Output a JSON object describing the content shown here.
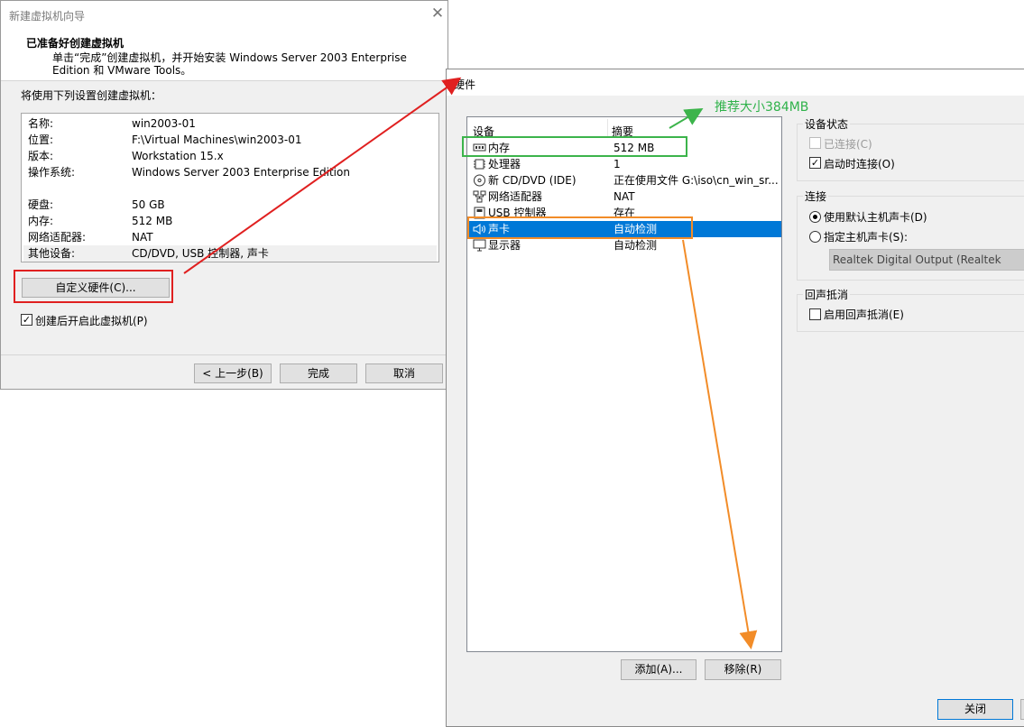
{
  "wizard": {
    "title": "新建虚拟机向导",
    "close_glyph": "✕",
    "heading": "已准备好创建虚拟机",
    "description": "单击“完成”创建虚拟机，并开始安装 Windows Server 2003 Enterprise Edition 和 VMware Tools。",
    "list_label": "将使用下列设置创建虚拟机：",
    "summary": [
      {
        "key": "名称:",
        "value": "win2003-01"
      },
      {
        "key": "位置:",
        "value": "F:\\Virtual Machines\\win2003-01"
      },
      {
        "key": "版本:",
        "value": "Workstation 15.x"
      },
      {
        "key": "操作系统:",
        "value": "Windows Server 2003 Enterprise Edition"
      },
      {
        "key": "硬盘:",
        "value": "50 GB"
      },
      {
        "key": "内存:",
        "value": "512 MB"
      },
      {
        "key": "网络适配器:",
        "value": "NAT"
      },
      {
        "key": "其他设备:",
        "value": "CD/DVD, USB 控制器, 声卡"
      }
    ],
    "customize_label": "自定义硬件(C)...",
    "power_on_label": "创建后开启此虚拟机(P)",
    "power_on_checked": true,
    "back_label": "< 上一步(B)",
    "finish_label": "完成",
    "cancel_label": "取消"
  },
  "hardware": {
    "title": "硬件",
    "col_device": "设备",
    "col_summary": "摘要",
    "devices": [
      {
        "name": "内存",
        "summary": "512 MB",
        "icon": "memory-icon"
      },
      {
        "name": "处理器",
        "summary": "1",
        "icon": "cpu-icon"
      },
      {
        "name": "新 CD/DVD (IDE)",
        "summary": "正在使用文件 G:\\iso\\cn_win_sr...",
        "icon": "cd-icon"
      },
      {
        "name": "网络适配器",
        "summary": "NAT",
        "icon": "network-icon"
      },
      {
        "name": "USB 控制器",
        "summary": "存在",
        "icon": "usb-icon"
      },
      {
        "name": "声卡",
        "summary": "自动检测",
        "icon": "speaker-icon",
        "selected": true
      },
      {
        "name": "显示器",
        "summary": "自动检测",
        "icon": "monitor-icon"
      }
    ],
    "add_label": "添加(A)...",
    "remove_label": "移除(R)",
    "close_label": "关闭",
    "device_status": {
      "title": "设备状态",
      "connected_label": "已连接(C)",
      "connected_checked": false,
      "connect_at_power_on_label": "启动时连接(O)",
      "connect_at_power_on_checked": true
    },
    "connection": {
      "title": "连接",
      "default_label": "使用默认主机声卡(D)",
      "specify_label": "指定主机声卡(S):",
      "selected": "default",
      "host_card_value": "Realtek Digital Output (Realtek"
    },
    "echo": {
      "title": "回声抵消",
      "enable_label": "启用回声抵消(E)",
      "enable_checked": false
    }
  },
  "annotations": {
    "memory_note": "推荐大小384MB",
    "colors": {
      "red": "#e02020",
      "green": "#3cb44b",
      "orange": "#f28c28"
    }
  }
}
